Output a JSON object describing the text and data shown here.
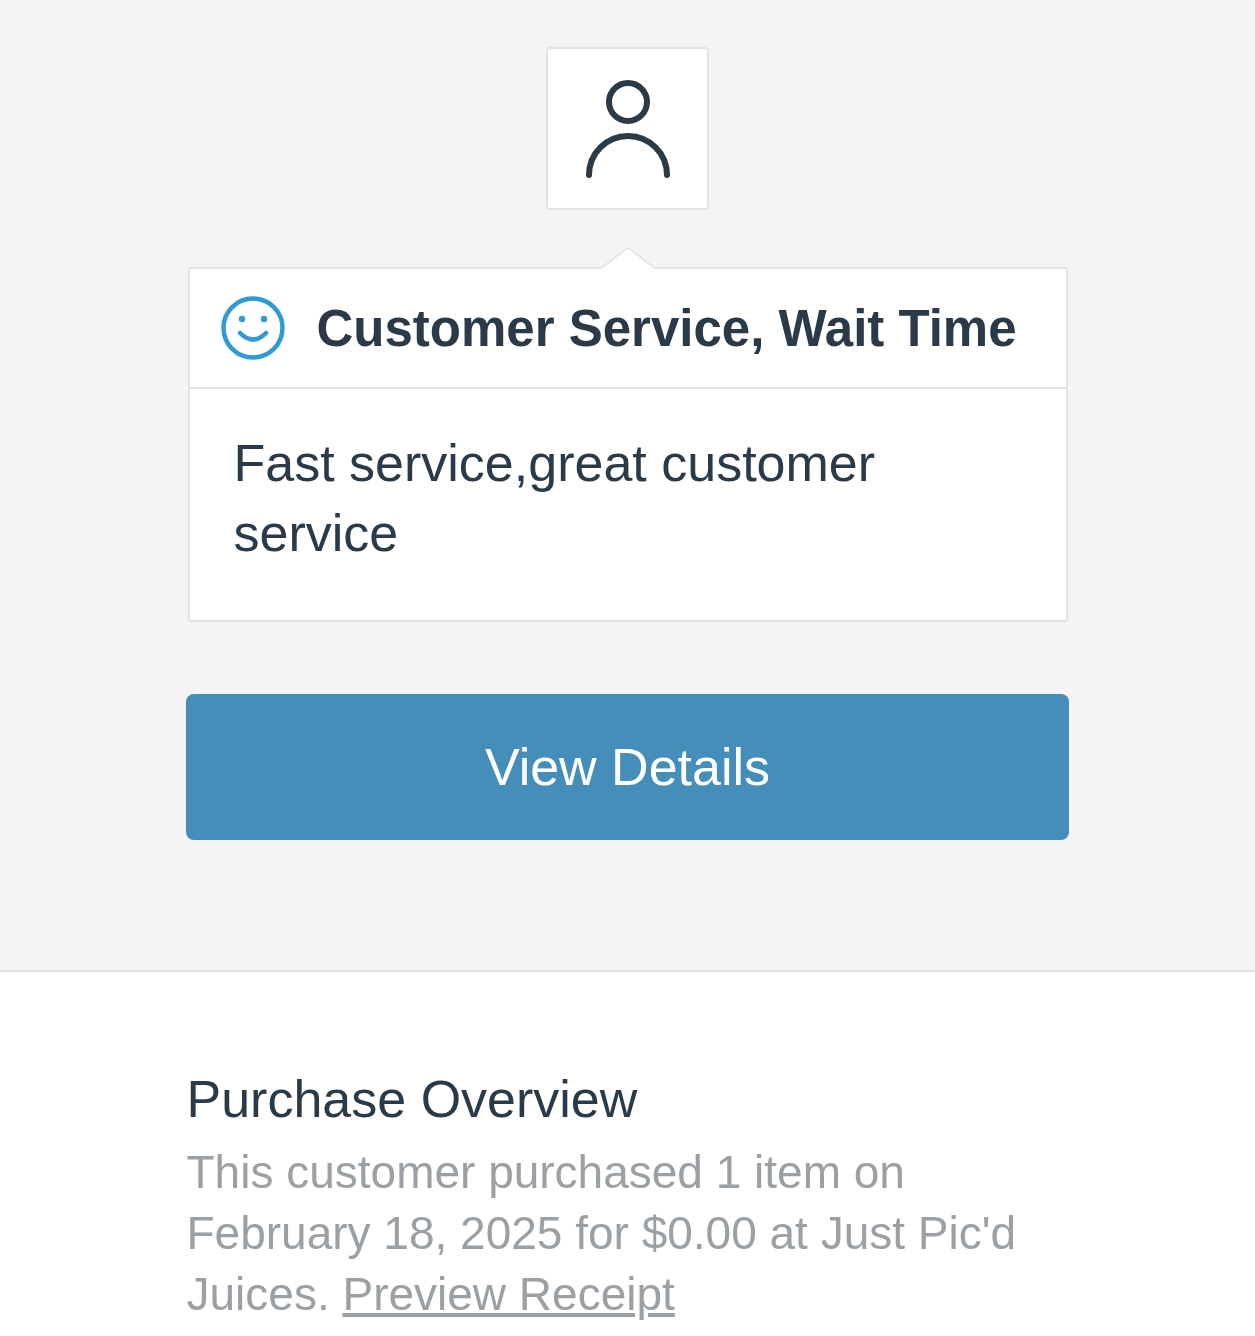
{
  "feedback": {
    "title": "Customer Service, Wait Time",
    "comment": "Fast service,great customer service"
  },
  "action_button": {
    "label": "View Details"
  },
  "purchase_overview": {
    "heading": "Purchase Overview",
    "summary": "This customer purchased 1 item on February 18, 2025 for $0.00 at Just Pic'd Juices.",
    "link": "Preview Receipt"
  }
}
